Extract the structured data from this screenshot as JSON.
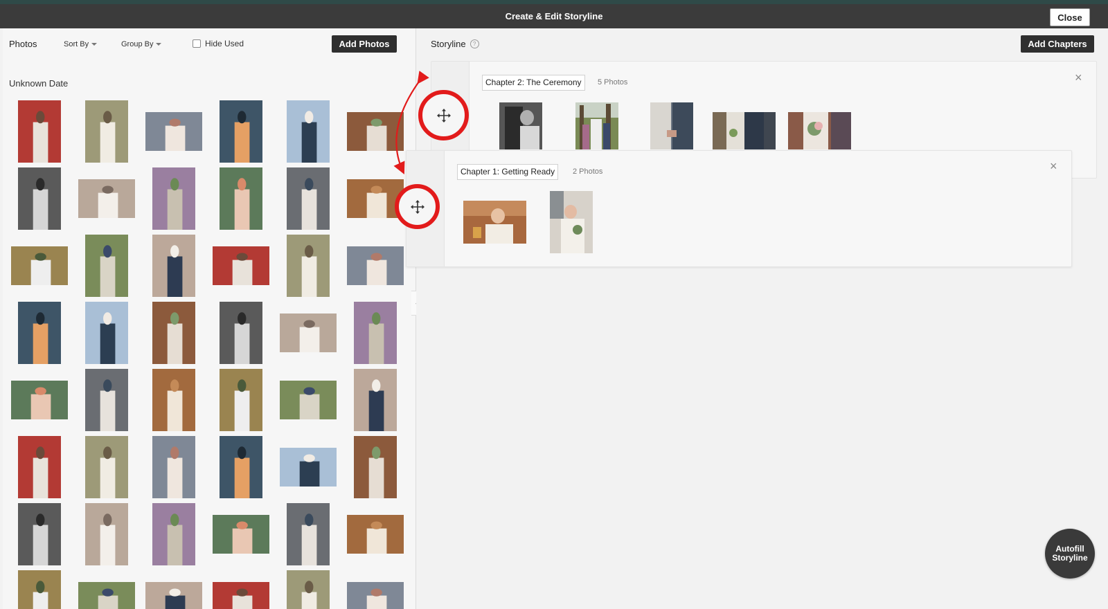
{
  "window": {
    "title": "Create & Edit Storyline",
    "close_label": "Close"
  },
  "photos_panel": {
    "title": "Photos",
    "sort_by": "Sort By",
    "group_by": "Group By",
    "hide_used": "Hide Used",
    "hide_used_checked": false,
    "add_photos": "Add Photos",
    "group_label": "Unknown Date"
  },
  "storyline": {
    "title": "Storyline",
    "help_icon": "question-circle-icon",
    "add_chapters": "Add Chapters",
    "chapters": [
      {
        "name": "Chapter 2: The Ceremony",
        "count": "5 Photos"
      },
      {
        "name": "Chapter 1: Getting Ready",
        "count": "2 Photos"
      }
    ],
    "autofill_line1": "Autofill",
    "autofill_line2": "Storyline"
  },
  "colors": {
    "titlebar": "#3b3b3b",
    "accent_dark": "#2f2f2f",
    "annotation": "#e21b1b"
  },
  "icons": {
    "move": "move-arrows-icon",
    "close": "close-x-icon",
    "collapse": "chevron-left-icon"
  }
}
